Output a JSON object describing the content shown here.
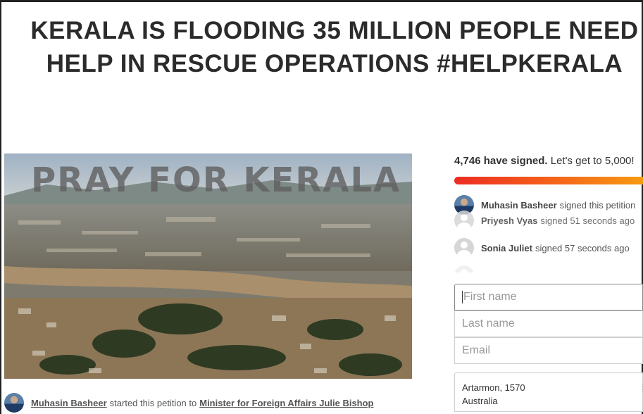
{
  "headline": "KERALA IS FLOODING 35 MILLION PEOPLE NEED HELP IN RESCUE OPERATIONS #HELPKERALA",
  "hero_image": {
    "overlay_text": "PRAY FOR KERALA"
  },
  "starter": {
    "name": "Muhasin Basheer",
    "middle": "started this petition to",
    "target": "Minister for Foreign Affairs Julie Bishop"
  },
  "signatures": {
    "count_text": "4,746 have signed.",
    "goal_text": "Let's get to 5,000!",
    "progress_fraction": 0.949
  },
  "recent_signers": [
    {
      "name": "Muhasin Basheer",
      "action": "signed this petition"
    },
    {
      "name": "Priyesh Vyas",
      "action": "signed 51 seconds ago"
    },
    {
      "name": "Sonia Juliet",
      "action": "signed 57 seconds ago"
    }
  ],
  "form": {
    "first_name_placeholder": "First name",
    "last_name_placeholder": "Last name",
    "email_placeholder": "Email",
    "address_line1": "Artarmon, 1570",
    "address_line2": "Australia"
  },
  "colors": {
    "progress_start": "#ec2c22",
    "progress_end": "#f79a12"
  }
}
